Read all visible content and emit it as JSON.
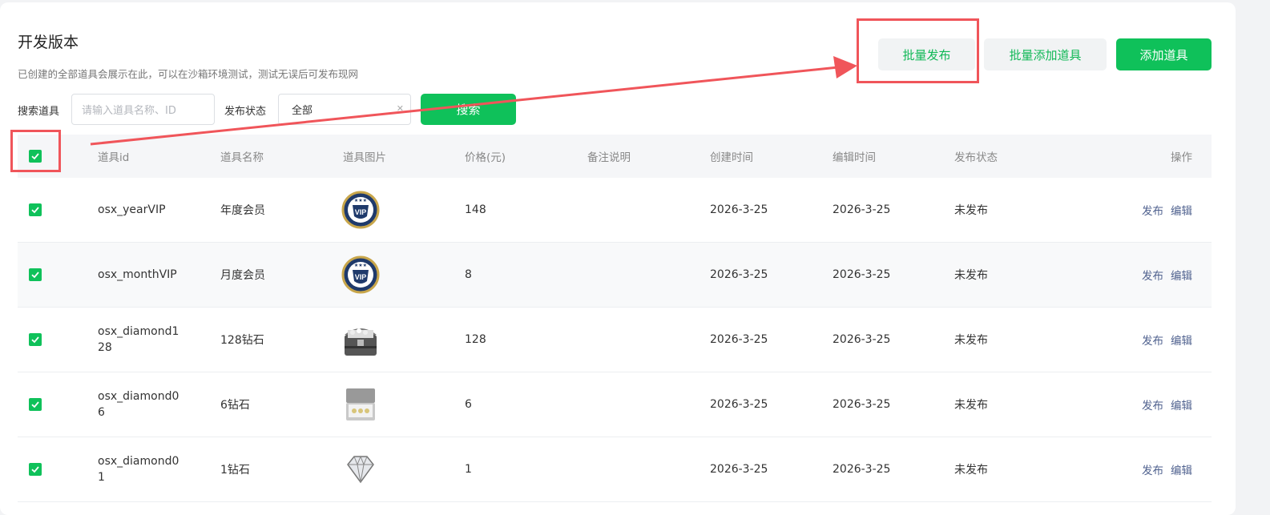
{
  "header": {
    "title": "开发版本",
    "description": "已创建的全部道具会展示在此，可以在沙箱环境测试，测试无误后可发布现网"
  },
  "actions": {
    "batch_publish": "批量发布",
    "batch_add": "批量添加道具",
    "add": "添加道具"
  },
  "filters": {
    "search_label": "搜索道具",
    "search_placeholder": "请输入道具名称、ID",
    "status_label": "发布状态",
    "status_value": "全部",
    "search_button": "搜索"
  },
  "table": {
    "columns": [
      "道具id",
      "道具名称",
      "道具图片",
      "价格(元)",
      "备注说明",
      "创建时间",
      "编辑时间",
      "发布状态",
      "操作"
    ],
    "rows": [
      {
        "id": "osx_yearVIP",
        "name": "年度会员",
        "image": "vip-badge-icon",
        "price": "148",
        "note": "",
        "created": "2026-3-25",
        "edited": "2026-3-25",
        "status": "未发布",
        "publish": "发布",
        "edit": "编辑"
      },
      {
        "id": "osx_monthVIP",
        "name": "月度会员",
        "image": "vip-badge-icon",
        "price": "8",
        "note": "",
        "created": "2026-3-25",
        "edited": "2026-3-25",
        "status": "未发布",
        "publish": "发布",
        "edit": "编辑"
      },
      {
        "id": "osx_diamond128",
        "name": "128钻石",
        "image": "treasure-chest-icon",
        "price": "128",
        "note": "",
        "created": "2026-3-25",
        "edited": "2026-3-25",
        "status": "未发布",
        "publish": "发布",
        "edit": "编辑"
      },
      {
        "id": "osx_diamond06",
        "name": "6钻石",
        "image": "diamond-box-icon",
        "price": "6",
        "note": "",
        "created": "2026-3-25",
        "edited": "2026-3-25",
        "status": "未发布",
        "publish": "发布",
        "edit": "编辑"
      },
      {
        "id": "osx_diamond01",
        "name": "1钻石",
        "image": "diamond-icon",
        "price": "1",
        "note": "",
        "created": "2026-3-25",
        "edited": "2026-3-25",
        "status": "未发布",
        "publish": "发布",
        "edit": "编辑"
      }
    ]
  },
  "colors": {
    "brand_green": "#0fc15a",
    "annotation_red": "#f0555a",
    "link_blue": "#50628f"
  }
}
